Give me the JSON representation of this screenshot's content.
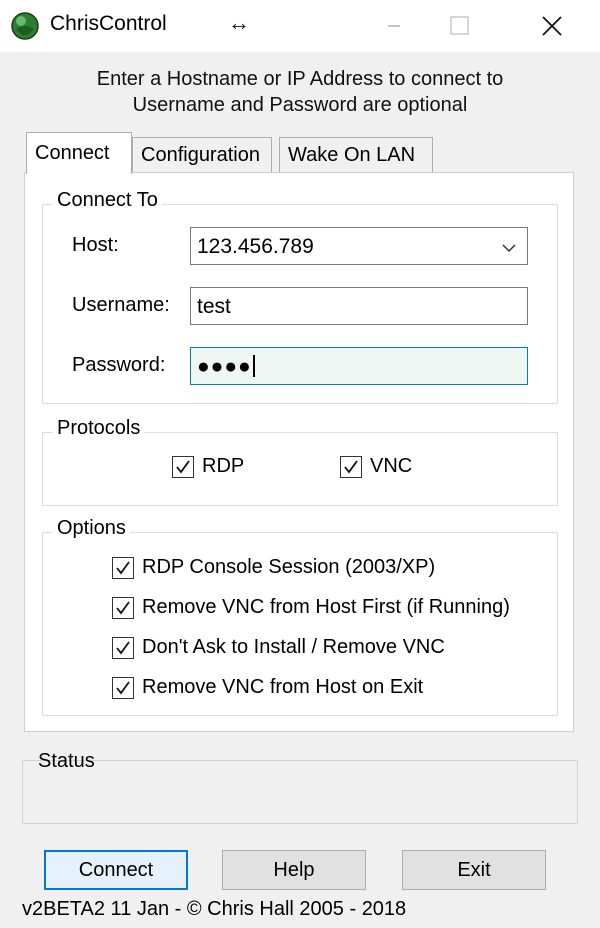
{
  "window": {
    "title": "ChrisControl",
    "icon": "globe-icon"
  },
  "instructions": {
    "line1": "Enter a Hostname or IP Address to connect to",
    "line2": "Username and Password are optional"
  },
  "tabs": [
    {
      "label": "Connect",
      "active": true
    },
    {
      "label": "Configuration",
      "active": false
    },
    {
      "label": "Wake On LAN",
      "active": false
    }
  ],
  "connect_to": {
    "group_label": "Connect To",
    "host_label": "Host:",
    "host_value": "123.456.789",
    "username_label": "Username:",
    "username_value": "test",
    "password_label": "Password:",
    "password_masked": "●●●●"
  },
  "protocols": {
    "group_label": "Protocols",
    "items": [
      {
        "label": "RDP",
        "checked": true
      },
      {
        "label": "VNC",
        "checked": true
      }
    ]
  },
  "options": {
    "group_label": "Options",
    "items": [
      {
        "label": "RDP Console Session (2003/XP)",
        "checked": true
      },
      {
        "label": "Remove VNC from Host First (if Running)",
        "checked": true
      },
      {
        "label": "Don't Ask to Install / Remove VNC",
        "checked": true
      },
      {
        "label": "Remove VNC from Host on Exit",
        "checked": true
      }
    ]
  },
  "status": {
    "label": "Status",
    "text": ""
  },
  "buttons": {
    "connect": "Connect",
    "help": "Help",
    "exit": "Exit"
  },
  "footer": "v2BETA2 11 Jan - © Chris Hall 2005 - 2018",
  "colors": {
    "accent": "#0078d7",
    "window_bg": "#f0f0f0"
  }
}
